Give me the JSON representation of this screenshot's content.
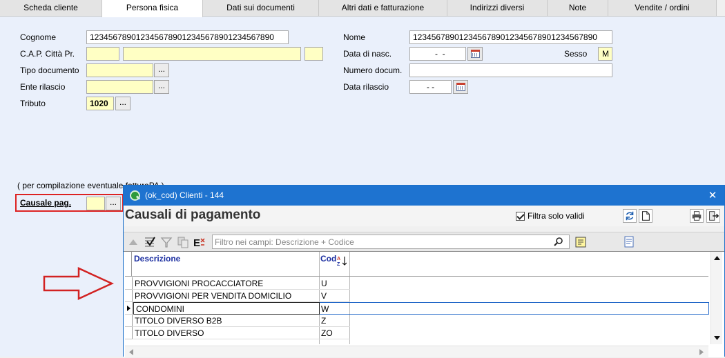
{
  "tabs": [
    {
      "label": "Scheda cliente"
    },
    {
      "label": "Persona fisica"
    },
    {
      "label": "Dati sui documenti"
    },
    {
      "label": "Altri dati e fatturazione"
    },
    {
      "label": "Indirizzi diversi"
    },
    {
      "label": "Note"
    },
    {
      "label": "Vendite / ordini"
    }
  ],
  "form": {
    "cognome_label": "Cognome",
    "cognome_value": "1234567890123456789012345678901234567890",
    "nome_label": "Nome",
    "nome_value": "1234567890123456789012345678901234567890",
    "cap_label": "C.A.P.  Città  Pr.",
    "data_nasc_label": "Data di nasc.",
    "data_nasc_value": "  -  -",
    "sesso_label": "Sesso",
    "sesso_value": "M",
    "tipo_doc_label": "Tipo documento",
    "numero_doc_label": "Numero docum.",
    "ente_label": "Ente rilascio",
    "data_rilascio_label": "Data rilascio",
    "data_rilascio_value": "-  -",
    "tributo_label": "Tributo",
    "tributo_value": "1020",
    "pa_note": "( per compilazione eventuale fatturaPA )",
    "causale_label": "Causale pag.",
    "dots": "..."
  },
  "dialog": {
    "title": "(ok_cod) Clienti - 144",
    "close": "✕",
    "heading": "Causali di pagamento",
    "filter_valid_label": "Filtra solo validi",
    "filter_placeholder": "Filtro nei campi: Descrizione + Codice",
    "columns": {
      "desc": "Descrizione",
      "cod": "Cod"
    },
    "rows": [
      {
        "desc": "PROVVIGIONI PROCACCIATORE",
        "cod": "U"
      },
      {
        "desc": "PROVVIGIONI PER VENDITA DOMICILIO",
        "cod": "V"
      },
      {
        "desc": "CONDOMINI",
        "cod": "W"
      },
      {
        "desc": "TITOLO DIVERSO B2B",
        "cod": "Z"
      },
      {
        "desc": "TITOLO DIVERSO",
        "cod": "ZO"
      }
    ]
  },
  "colors": {
    "title_bar": "#1e73d0",
    "required_field": "#ffffc4",
    "highlight": "#d22222"
  }
}
